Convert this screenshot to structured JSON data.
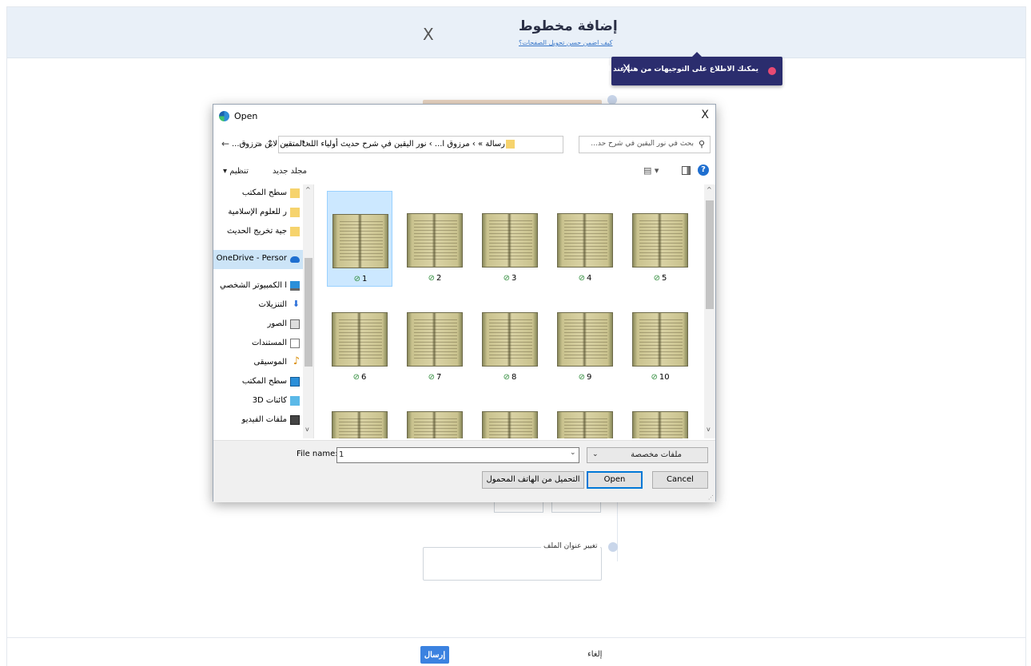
{
  "modal": {
    "title": "إضافة مخطوط",
    "help_link": "كيف اضمن حسن تحويل الصفحات؟",
    "close_glyph": "X",
    "tooltip_text": "يمكنك الاطلاع على التوجيهات من هنا عند الحاجة.",
    "tooltip_close": "X",
    "rename_label": "تغيير عنوان الملف",
    "send_label": "إرسال",
    "cancel_label": "إلغاء"
  },
  "dialog": {
    "title": "Open",
    "close_glyph": "X",
    "nav": {
      "back": "←",
      "forward": "→",
      "recent": "⌄",
      "up": "↑"
    },
    "address": "رسالة » › مرزوق ا... › نور اليقين في شرح حديث أولياء الله المتقين لابن مرزوق...",
    "address_dropdown": "⌄",
    "address_refresh": "↻",
    "search_placeholder": "بحث في نور اليقين في شرح حد...",
    "toolbar": {
      "organize": "تنظيم ▾",
      "new_folder": "مجلد جديد",
      "help": "?"
    },
    "nav_items": [
      {
        "label": "سطح المكتب",
        "icon": "folder-icon"
      },
      {
        "label": "ر للعلوم الإسلامية",
        "icon": "folder-icon"
      },
      {
        "label": "جية تخريج الحديث",
        "icon": "folder-icon"
      },
      {
        "label": "OneDrive - Persor",
        "icon": "onedrive-icon"
      },
      {
        "label": "ا الكمبيوتر الشخصي",
        "icon": "computer-icon"
      },
      {
        "label": "التنزيلات",
        "icon": "download-icon"
      },
      {
        "label": "الصور",
        "icon": "pictures-icon"
      },
      {
        "label": "المستندات",
        "icon": "documents-icon"
      },
      {
        "label": "الموسيقى",
        "icon": "music-icon"
      },
      {
        "label": "سطح المكتب",
        "icon": "desktop-icon"
      },
      {
        "label": "كائنات 3D",
        "icon": "3d-objects-icon"
      },
      {
        "label": "ملفات الفيديو",
        "icon": "video-icon"
      }
    ],
    "files": [
      "1",
      "2",
      "3",
      "4",
      "5",
      "6",
      "7",
      "8",
      "9",
      "10",
      "",
      "",
      "",
      "",
      ""
    ],
    "file_name_label": "File name:",
    "file_name_value": "1",
    "file_type": "ملفات مخصصة",
    "open_label": "Open",
    "cancel_label": "Cancel",
    "mobile_label": "التحميل من الهاتف المحمول"
  },
  "colors": {
    "header_bg": "#e9f0f8",
    "tooltip_bg": "#2b2d6e",
    "send_button": "#3b82e0",
    "selection": "#cce8ff"
  }
}
